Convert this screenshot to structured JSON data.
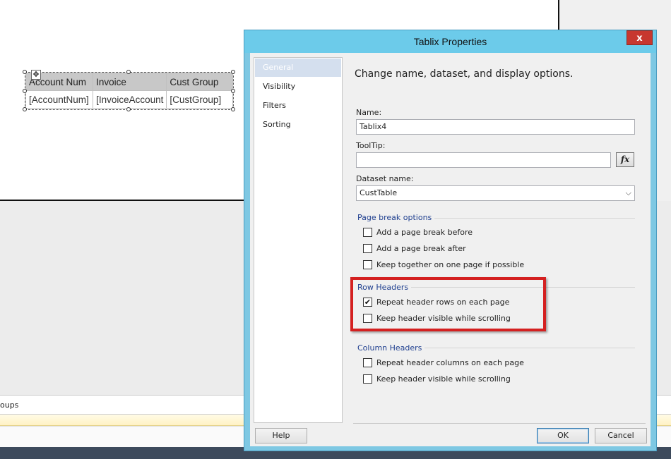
{
  "background": {
    "groups_label": "oups",
    "tablix": {
      "headers": [
        "Account Num",
        "Invoice",
        "Cust Group"
      ],
      "cells": [
        "[AccountNum]",
        "[InvoiceAccount",
        "[CustGroup]"
      ]
    }
  },
  "dialog": {
    "title": "Tablix Properties",
    "close_glyph": "x",
    "nav": [
      "General",
      "Visibility",
      "Filters",
      "Sorting"
    ],
    "heading": "Change name, dataset, and display options.",
    "name_label": "Name:",
    "name_value": "Tablix4",
    "tooltip_label": "ToolTip:",
    "tooltip_value": "",
    "fx_label": "fx",
    "dataset_label": "Dataset name:",
    "dataset_value": "CustTable",
    "page_break": {
      "title": "Page break options",
      "options": [
        {
          "label": "Add a page break before",
          "checked": false
        },
        {
          "label": "Add a page break after",
          "checked": false
        },
        {
          "label": "Keep together on one page if possible",
          "checked": false
        }
      ]
    },
    "row_headers": {
      "title": "Row Headers",
      "options": [
        {
          "label": "Repeat header rows on each page",
          "checked": true
        },
        {
          "label": "Keep header visible while scrolling",
          "checked": false
        }
      ]
    },
    "column_headers": {
      "title": "Column Headers",
      "options": [
        {
          "label": "Repeat header columns on each page",
          "checked": false
        },
        {
          "label": "Keep header visible while scrolling",
          "checked": false
        }
      ]
    },
    "help_button": "Help",
    "ok_button": "OK",
    "cancel_button": "Cancel",
    "accent_color": "#6ccbea",
    "highlight_color": "#d42020"
  }
}
